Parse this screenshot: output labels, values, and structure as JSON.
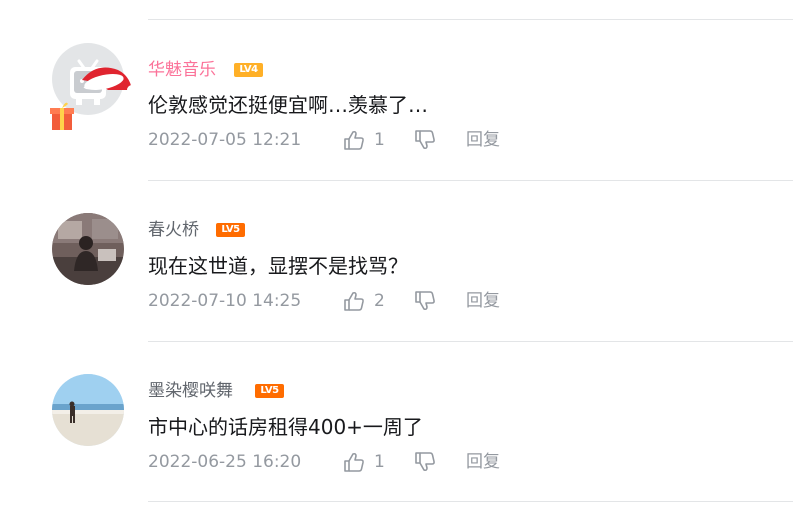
{
  "comments": [
    {
      "username": "华魅音乐",
      "username_color": "#fb7299",
      "level": "LV4",
      "level_color": "#ffb027",
      "content": "伦敦感觉还挺便宜啊…羡慕了…",
      "time": "2022-07-05 12:21",
      "likes": "1",
      "reply_label": "回复",
      "avatar_icon": "default-tv-avatar-icon",
      "pendant_icon": "christmas-hat-gift-pendant-icon"
    },
    {
      "username": "春火桥",
      "username_color": "#61666d",
      "level": "LV5",
      "level_color": "#ff6c00",
      "content": "现在这世道，显摆不是找骂？",
      "time": "2022-07-10 14:25",
      "likes": "2",
      "reply_label": "回复",
      "avatar_icon": "person-at-desk-photo-avatar-icon"
    },
    {
      "username": "墨染樱咲舞",
      "username_color": "#61666d",
      "level": "LV5",
      "level_color": "#ff6c00",
      "content": "市中心的话房租得400+一周了",
      "time": "2022-06-25 16:20",
      "likes": "1",
      "reply_label": "回复",
      "avatar_icon": "person-on-beach-photo-avatar-icon"
    }
  ],
  "colors": {
    "text": "#18191c",
    "meta": "#9499a0",
    "divider": "#e3e5e7"
  }
}
